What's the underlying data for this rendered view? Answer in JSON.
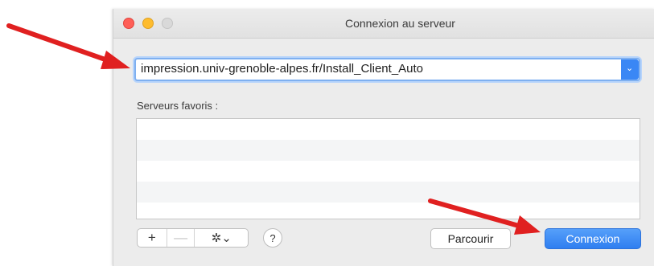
{
  "window": {
    "title": "Connexion au serveur"
  },
  "address": {
    "value": "impression.univ-grenoble-alpes.fr/Install_Client_Auto",
    "dropdown_icon": "chevron-down-icon"
  },
  "favorites": {
    "label": "Serveurs favoris :",
    "items": []
  },
  "toolbar": {
    "add": "+",
    "remove": "—",
    "actions_icon": "gear-icon",
    "actions_glyph": "✲⌄",
    "help": "?"
  },
  "buttons": {
    "browse": "Parcourir",
    "connect": "Connexion"
  },
  "colors": {
    "accent": "#3a87f5",
    "annotation_arrow": "#e02020",
    "close": "#ff5f57",
    "minimize": "#febc2e"
  }
}
